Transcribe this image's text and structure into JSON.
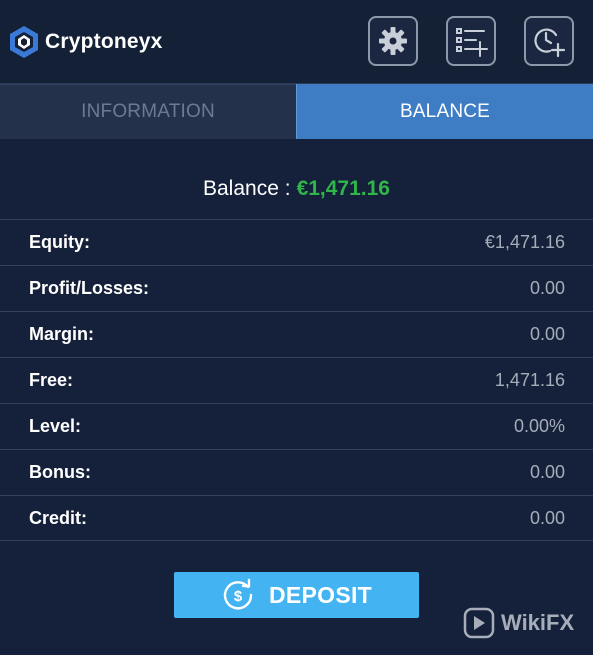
{
  "header": {
    "brand": "Cryptoneyx",
    "buttons": {
      "settings": "gear-icon",
      "add_list": "list-add-icon",
      "add_clock": "clock-add-icon"
    }
  },
  "tabs": [
    {
      "label": "INFORMATION",
      "active": false
    },
    {
      "label": "BALANCE",
      "active": true
    }
  ],
  "balance": {
    "label": "Balance :",
    "amount": "€1,471.16"
  },
  "rows": [
    {
      "label": "Equity:",
      "value": "€1,471.16"
    },
    {
      "label": "Profit/Losses:",
      "value": "0.00"
    },
    {
      "label": "Margin:",
      "value": "0.00"
    },
    {
      "label": "Free:",
      "value": "1,471.16"
    },
    {
      "label": "Level:",
      "value": "0.00%"
    },
    {
      "label": "Bonus:",
      "value": "0.00"
    },
    {
      "label": "Credit:",
      "value": "0.00"
    }
  ],
  "deposit": {
    "label": "DEPOSIT",
    "icon": "dollar-cycle-icon"
  },
  "watermark": {
    "text": "WikiFX"
  },
  "colors": {
    "background": "#15213a",
    "accent_tab": "#3e7cc4",
    "balance_amount": "#2fb54a",
    "deposit_button": "#44b3f2"
  }
}
